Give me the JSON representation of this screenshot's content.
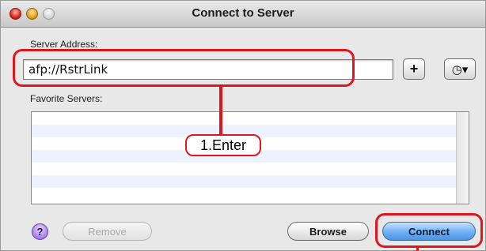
{
  "window": {
    "title": "Connect to Server"
  },
  "server_address": {
    "label": "Server Address:",
    "value": "afp://RstrLink"
  },
  "favorites": {
    "label": "Favorite Servers:",
    "rows": [
      "",
      "",
      "",
      "",
      "",
      "",
      ""
    ]
  },
  "buttons": {
    "add": "+",
    "recent": "◷▾",
    "help": "?",
    "remove": "Remove",
    "browse": "Browse",
    "connect": "Connect"
  },
  "annotation": {
    "callout": "1.Enter",
    "color": "#e0161f"
  },
  "colors": {
    "connect_accent": "#6fb0f3",
    "list_alt_row": "#edf3fe"
  },
  "icons": {
    "close": "close-light-icon",
    "minimize": "minimize-light-icon",
    "zoom": "zoom-light-icon",
    "help": "help-icon",
    "recent": "clock-icon"
  }
}
